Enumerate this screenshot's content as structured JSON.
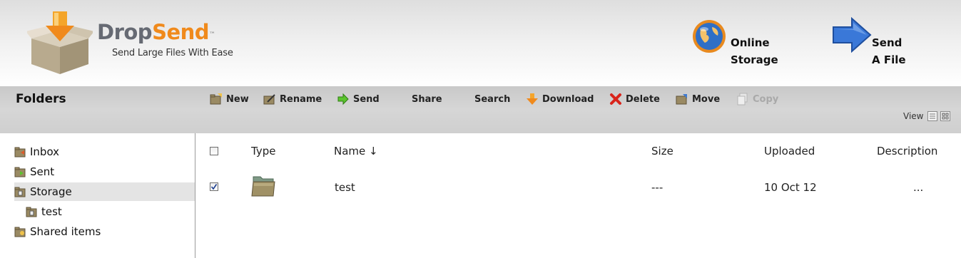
{
  "header": {
    "brand_part1": "Drop",
    "brand_part2": "Send",
    "brand_tm": "™",
    "tagline": "Send Large Files With Ease",
    "online_storage_label": "Online\nStorage",
    "send_file_label": "Send\nA File",
    "icons": {
      "logo": "box-arrow-logo-icon",
      "online_storage": "globe-icon",
      "send_file": "blue-arrow-icon"
    }
  },
  "toolbar": {
    "title": "Folders",
    "buttons": [
      {
        "label": "New",
        "icon": "new-folder-icon",
        "enabled": true
      },
      {
        "label": "Rename",
        "icon": "rename-icon",
        "enabled": true
      },
      {
        "label": "Send",
        "icon": "green-arrow-icon",
        "enabled": true
      },
      {
        "label": "Share",
        "icon": "",
        "enabled": true
      },
      {
        "label": "Search",
        "icon": "",
        "enabled": true
      },
      {
        "label": "Download",
        "icon": "orange-down-arrow-icon",
        "enabled": true
      },
      {
        "label": "Delete",
        "icon": "red-x-icon",
        "enabled": true
      },
      {
        "label": "Move",
        "icon": "move-icon",
        "enabled": true
      },
      {
        "label": "Copy",
        "icon": "copy-icon",
        "enabled": false
      }
    ],
    "view_label": "View",
    "view_icons": [
      "list-view-icon",
      "grid-view-icon"
    ]
  },
  "sidebar": {
    "items": [
      {
        "label": "Inbox",
        "icon": "inbox-folder-icon",
        "selected": false,
        "indent": false
      },
      {
        "label": "Sent",
        "icon": "sent-folder-icon",
        "selected": false,
        "indent": false
      },
      {
        "label": "Storage",
        "icon": "storage-folder-icon",
        "selected": true,
        "indent": false
      },
      {
        "label": "test",
        "icon": "storage-folder-icon",
        "selected": false,
        "indent": true
      },
      {
        "label": "Shared items",
        "icon": "shared-folder-icon",
        "selected": false,
        "indent": false
      }
    ]
  },
  "table": {
    "columns": {
      "type": "Type",
      "name": "Name ↓",
      "size": "Size",
      "uploaded": "Uploaded",
      "description": "Description"
    },
    "rows": [
      {
        "checked": true,
        "type_icon": "folder-icon",
        "name": "test",
        "size": "---",
        "uploaded": "10 Oct 12",
        "description": "..."
      }
    ]
  },
  "colors": {
    "brand_gray": "#666a73",
    "brand_orange": "#f08a1c",
    "selected_row": "#e4e4e4",
    "toolbar_bg": "#cfcfcf"
  }
}
